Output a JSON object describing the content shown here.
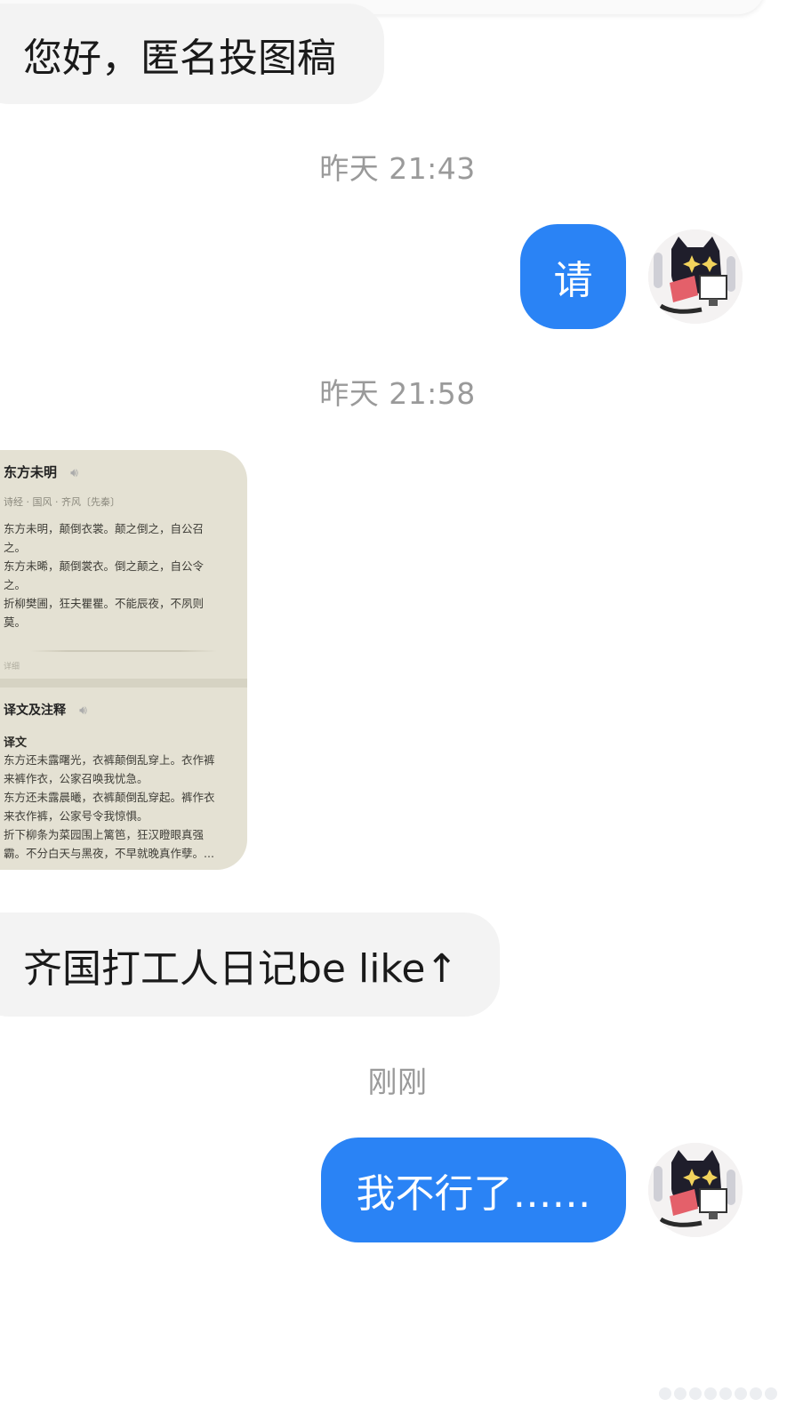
{
  "messages": {
    "m1_text": "您好，匿名投图稿",
    "ts1": "昨天 21:43",
    "m2_text": "请",
    "ts2": "昨天 21:58",
    "m4_text": "齐国打工人日记be like↑",
    "ts3": "刚刚",
    "m5_text": "我不行了……"
  },
  "poem_image": {
    "title": "东方未明",
    "meta": "诗经 · 国风 · 齐风〔先秦〕",
    "lines": [
      "东方未明，颠倒衣裳。颠之倒之，自公召",
      "之。",
      "东方未晞，颠倒裳衣。倒之颠之，自公令",
      "之。",
      "折柳樊圃，狂夫瞿瞿。不能辰夜，不夙则",
      "莫。"
    ],
    "small_note": "详细",
    "trans_title": "译文及注释",
    "trans_label": "译文",
    "trans_lines": [
      "东方还未露曙光，衣裤颠倒乱穿上。衣作裤",
      "来裤作衣，公家召唤我忧急。",
      "东方还未露晨曦，衣裤颠倒乱穿起。裤作衣",
      "来衣作裤，公家号令我惊惧。",
      "折下柳条为菜园围上篱笆，狂汉瞪眼真强",
      "霸。不分白天与黑夜，不早就晚真作孽。..."
    ]
  },
  "colors": {
    "outgoing_bubble": "#2a83f5",
    "incoming_bubble": "#f3f3f3",
    "timestamp": "#9a9a9a"
  },
  "icons": {
    "avatar": "cat-avatar-icon",
    "speaker": "speaker-icon"
  }
}
